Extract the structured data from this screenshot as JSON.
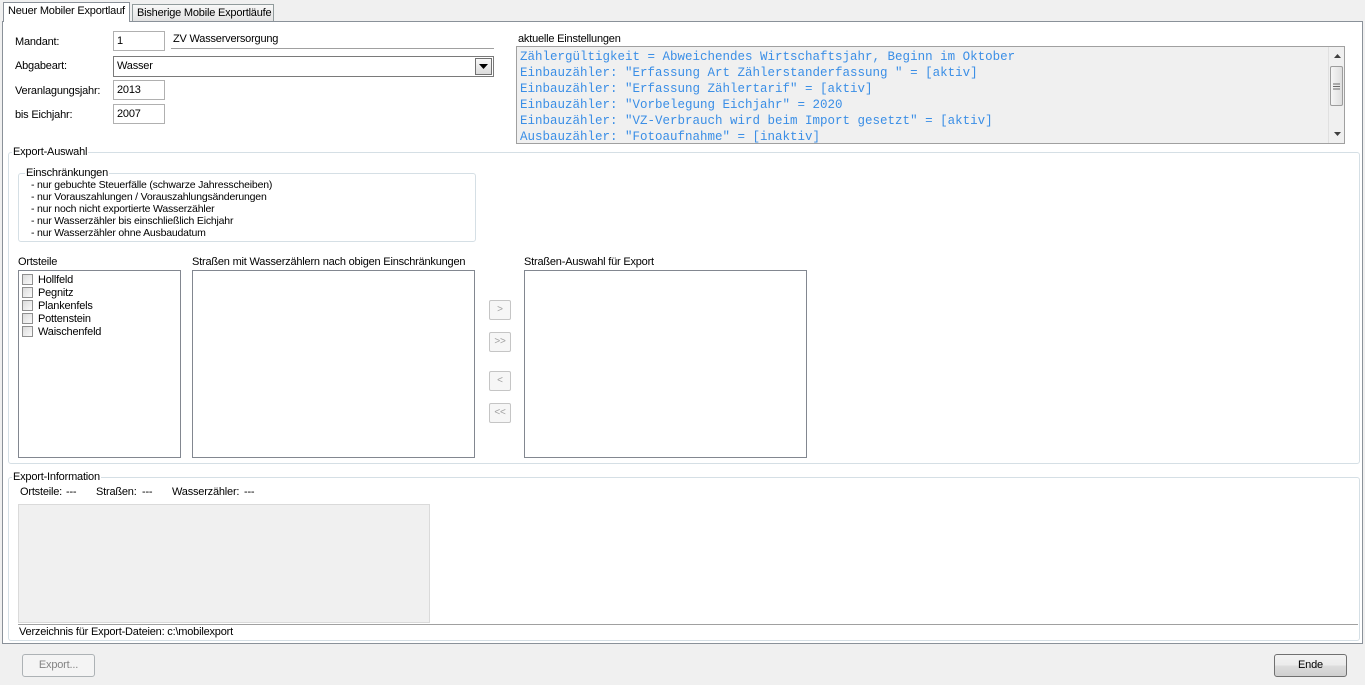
{
  "tabs": [
    {
      "label": "Neuer Mobiler Exportlauf",
      "active": true
    },
    {
      "label": "Bisherige Mobile Exportläufe",
      "active": false
    }
  ],
  "form": {
    "mandant_label": "Mandant:",
    "mandant_value": "1",
    "mandant_name": "ZV Wasserversorgung",
    "abgabeart_label": "Abgabeart:",
    "abgabeart_value": "Wasser",
    "veranlagungsjahr_label": "Veranlagungsjahr:",
    "veranlagungsjahr_value": "2013",
    "eichjahr_label": "bis Eichjahr:",
    "eichjahr_value": "2007"
  },
  "settings": {
    "title": "aktuelle Einstellungen",
    "lines": [
      "Zählergültigkeit = Abweichendes Wirtschaftsjahr, Beginn im Oktober",
      "Einbauzähler: \"Erfassung Art Zählerstanderfassung \" = [aktiv]",
      "Einbauzähler: \"Erfassung Zählertarif\" = [aktiv]",
      "Einbauzähler: \"Vorbelegung Eichjahr\" = 2020",
      "Einbauzähler: \"VZ-Verbrauch wird beim Import gesetzt\" = [aktiv]",
      "Ausbauzähler: \"Fotoaufnahme\" = [inaktiv]"
    ],
    "text_color": "#3a8ee6"
  },
  "export_selection": {
    "title": "Export-Auswahl",
    "restrictions_title": "Einschränkungen",
    "restrictions": [
      "- nur gebuchte Steuerfälle (schwarze Jahresscheiben)",
      "- nur Vorauszahlungen / Vorauszahlungsänderungen",
      "- nur noch nicht exportierte Wasserzähler",
      "- nur Wasserzähler bis einschließlich Eichjahr",
      "- nur Wasserzähler ohne Ausbaudatum"
    ],
    "ortsteile_label": "Ortsteile",
    "ortsteile": [
      "Hollfeld",
      "Pegnitz",
      "Plankenfels",
      "Pottenstein",
      "Waischenfeld"
    ],
    "strassen_label": "Straßen mit Wasserzählern nach obigen Einschränkungen",
    "auswahl_label": "Straßen-Auswahl für Export",
    "move_buttons": [
      ">",
      ">>",
      "<",
      "<<"
    ]
  },
  "export_info": {
    "title": "Export-Information",
    "ortsteile_label": "Ortsteile:",
    "ortsteile_value": "---",
    "strassen_label": "Straßen:",
    "strassen_value": "---",
    "wasserzaehler_label": "Wasserzähler:",
    "wasserzaehler_value": "---",
    "directory_text": "Verzeichnis für Export-Dateien: c:\\mobilexport"
  },
  "buttons": {
    "export_label": "Export...",
    "ende_label": "Ende"
  },
  "icons": [
    "chevron-down-icon",
    "scroll-up-icon",
    "scroll-down-icon",
    "checkbox-icon"
  ]
}
